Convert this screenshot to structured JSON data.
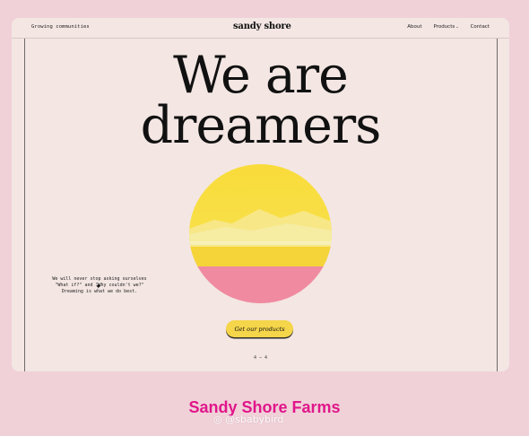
{
  "header": {
    "tagline": "Growing communities",
    "logo": "sandy shore",
    "nav": [
      "About",
      "Products",
      "Contact"
    ]
  },
  "hero": {
    "line1": "We are",
    "line2": "dreamers",
    "blurb": [
      "We will never stop asking ourselves",
      "\"What if?\" and \"Why couldn't we?\"",
      "Dreaming is what we do best."
    ],
    "cta_label": "Get our products",
    "pager": "4 — 4"
  },
  "caption": "Sandy Shore Farms",
  "watermark": "@sbabybird",
  "colors": {
    "page_bg": "#f0d1d8",
    "card_bg": "#f3e6e3",
    "accent_yellow": "#f5d54a",
    "accent_pink": "#f08aa0",
    "caption": "#e0168a"
  },
  "icons": [
    "sparkle-icon",
    "chevron-down-icon",
    "weibo-icon"
  ]
}
